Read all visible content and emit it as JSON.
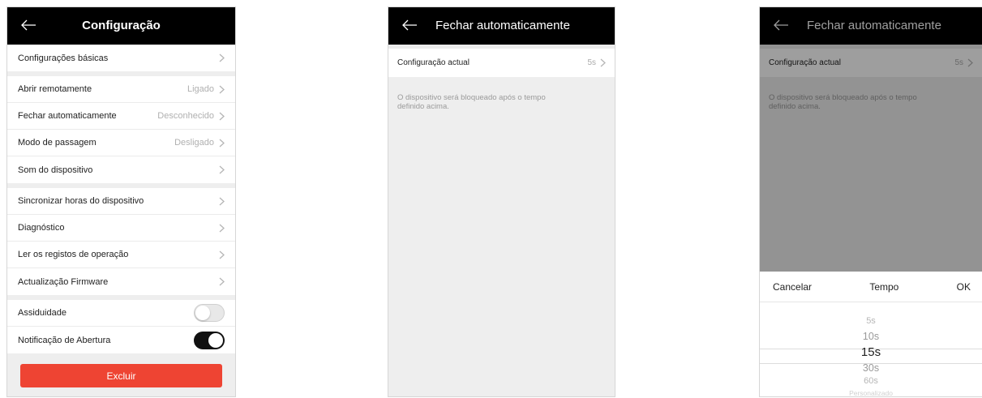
{
  "screen1": {
    "title": "Configuração",
    "groups": [
      [
        {
          "label": "Configurações básicas",
          "value": ""
        }
      ],
      [
        {
          "label": "Abrir remotamente",
          "value": "Ligado"
        },
        {
          "label": "Fechar automaticamente",
          "value": "Desconhecido"
        },
        {
          "label": "Modo de passagem",
          "value": "Desligado"
        },
        {
          "label": "Som do dispositivo",
          "value": ""
        }
      ],
      [
        {
          "label": "Sincronizar horas do dispositivo",
          "value": ""
        },
        {
          "label": "Diagnóstico",
          "value": ""
        },
        {
          "label": "Ler os registos de operação",
          "value": ""
        },
        {
          "label": "Actualização Firmware",
          "value": ""
        }
      ]
    ],
    "toggles": [
      {
        "label": "Assiduidade",
        "on": false
      },
      {
        "label": "Notificação de Abertura",
        "on": true
      }
    ],
    "delete_label": "Excluir"
  },
  "screen2": {
    "title": "Fechar automaticamente",
    "setting_label": "Configuração actual",
    "setting_value": "5s",
    "description": "O dispositivo será bloqueado após o tempo definido acima."
  },
  "screen3": {
    "title": "Fechar automaticamente",
    "setting_label": "Configuração actual",
    "setting_value": "5s",
    "description": "O dispositivo será bloqueado após o tempo definido acima.",
    "picker": {
      "cancel": "Cancelar",
      "title": "Tempo",
      "ok": "OK",
      "options": [
        "5s",
        "10s",
        "15s",
        "30s",
        "60s",
        "Personalizado"
      ],
      "selected": "15s"
    }
  },
  "colors": {
    "accent_red": "#ee4433",
    "header_black": "#000000",
    "toggle_on": "#111111"
  },
  "icons": {
    "back": "back-arrow-icon",
    "chevron": "chevron-right-icon"
  }
}
